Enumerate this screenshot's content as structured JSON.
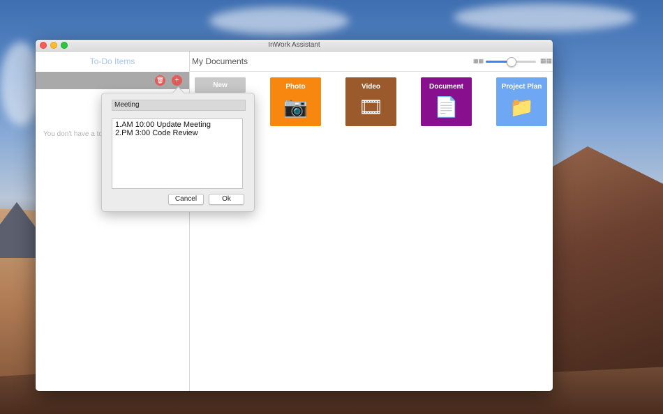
{
  "window": {
    "title": "InWork Assistant"
  },
  "sidebar": {
    "title": "To-Do Items",
    "delete_icon": "trash-icon",
    "add_icon": "plus-icon",
    "empty_text": "You don't have a to"
  },
  "main": {
    "title": "My Documents",
    "zoom": {
      "small_icon": "grid-small-icon",
      "large_icon": "grid-large-icon",
      "value_fraction": 0.5
    },
    "tiles": [
      {
        "label": "New",
        "color": "#c8c8c8"
      },
      {
        "label": "Photo",
        "color": "#f7870e",
        "icon": "camera-icon"
      },
      {
        "label": "Video",
        "color": "#9a5a2b",
        "icon": "film-icon"
      },
      {
        "label": "Document",
        "color": "#88108e",
        "icon": "document-icon"
      },
      {
        "label": "Project Plan",
        "color": "#6ea8f5",
        "icon": "folder-icon"
      }
    ]
  },
  "dialog": {
    "title_value": "Meeting",
    "note_value": "1.AM 10:00 Update Meeting\n2.PM 3:00 Code Review",
    "cancel_label": "Cancel",
    "ok_label": "Ok"
  }
}
